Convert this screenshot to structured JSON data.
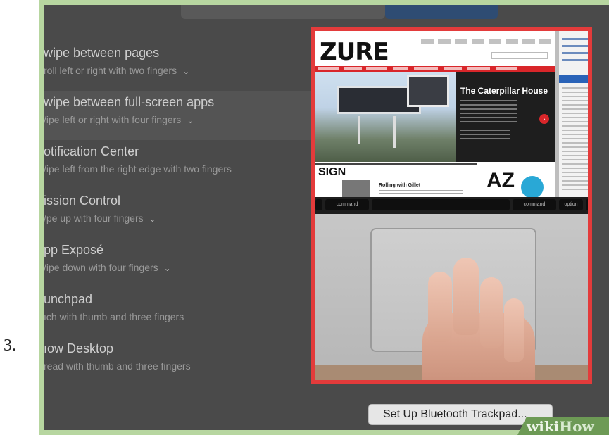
{
  "step_number": "3.",
  "gestures": [
    {
      "title": "wipe between pages",
      "subtitle": "roll left or right with two fingers",
      "has_menu": true,
      "selected": false
    },
    {
      "title": "wipe between full-screen apps",
      "subtitle": "/ipe left or right with four fingers",
      "has_menu": true,
      "selected": true
    },
    {
      "title": "otification Center",
      "subtitle": "/ipe left from the right edge with two fingers",
      "has_menu": false,
      "selected": false
    },
    {
      "title": "ission Control",
      "subtitle": "/pe up with four fingers",
      "has_menu": true,
      "selected": false
    },
    {
      "title": "pp Exposé",
      "subtitle": "/ipe down with four fingers",
      "has_menu": true,
      "selected": false
    },
    {
      "title": "unchpad",
      "subtitle": "ıch with thumb and three fingers",
      "has_menu": false,
      "selected": false
    },
    {
      "title": "ıow Desktop",
      "subtitle": "read with thumb and three fingers",
      "has_menu": false,
      "selected": false
    }
  ],
  "preview": {
    "site_logo": "ZURE",
    "article_title": "The Caterpillar House",
    "section_heading": "SIGN",
    "side_article": "Rolling with Gillet",
    "awards_logo": "AZ",
    "keys": [
      "command",
      "command",
      "option"
    ]
  },
  "setup_button": "Set Up Bluetooth Trackpad...",
  "watermark": {
    "wiki": "wiki",
    "how": "How"
  },
  "colors": {
    "highlight": "#e33b3b",
    "panel_bg": "#4a4a4a",
    "frame_green": "#b7d6a0"
  }
}
